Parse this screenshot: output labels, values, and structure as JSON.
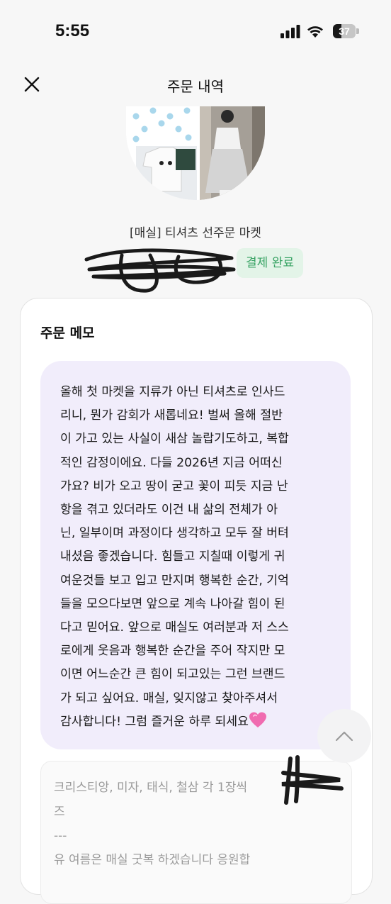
{
  "status_bar": {
    "time": "5:55",
    "battery": "37",
    "battery_level": 0.37
  },
  "header": {
    "title": "주문 내역"
  },
  "shop": {
    "name": "[매실] 티셔츠 선주문 마켓"
  },
  "order": {
    "status": "결제 완료"
  },
  "memo_section": {
    "title": "주문 메모",
    "text": "올해 첫 마켓을 지류가 아닌 티셔츠로 인사드\n리니, 뭔가 감회가 새롭네요! 벌써 올해 절반\n이 가고 있는 사실이 새삼 놀랍기도하고, 복합\n적인 감정이에요. 다들 2026년 지금 어떠신\n가요? 비가 오고 땅이 굳고 꽃이 피듯 지금 난\n항을 겪고 있더라도 이건 내 삶의 전체가 아\n닌, 일부이며 과정이다 생각하고 모두 잘 버텨\n내셨음 좋겠습니다. 힘들고 지칠때 이렇게 귀\n여운것들 보고 입고 만지며 행복한 순간, 기억\n들을 모으다보면 앞으로 계속 나아갈 힘이 된\n다고 믿어요. 앞으로 매실도 여러분과 저 스스\n로에게 웃음과 행복한 순간을 주어 작지만 모\n이면 어느순간 큰 힘이 되고있는 그런 브랜드\n가 되고 싶어요. 매실, 잊지않고 찾아주셔서\n감사합니다! 그럼 즐거운 하루 되세요",
    "items_text": "크리스티앙, 미자, 태식, 철삼 각 1장씩\n즈\n---\n유 여름은 매실 굿복 하겠습니다 응원합"
  },
  "icons": {
    "close": "close-icon",
    "scroll_top": "chevron-up-icon",
    "heart": "pink-heart-icon"
  },
  "colors": {
    "badge_bg": "#e3f4e8",
    "badge_text": "#38a364",
    "memo_bg": "#f1edfb",
    "heart": "#f06bb0"
  }
}
